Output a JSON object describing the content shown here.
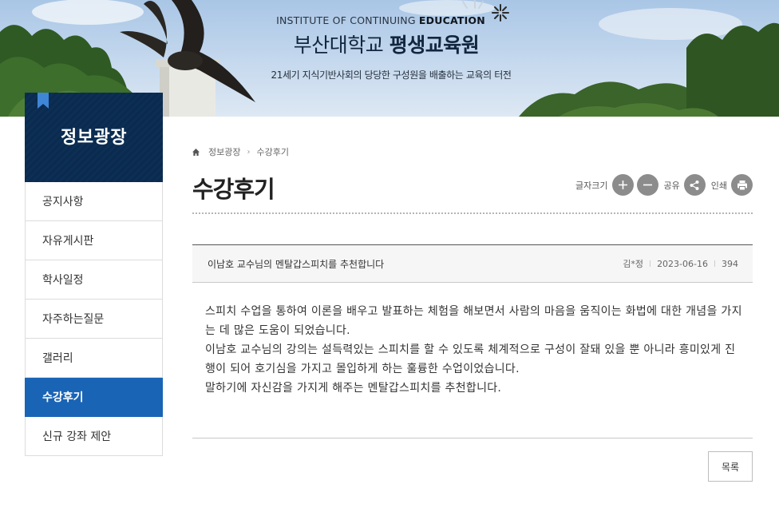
{
  "banner": {
    "institute_en_regular": "INSTITUTE OF CONTINUING ",
    "institute_en_bold": "EDUCATION",
    "name_regular": "부산대학교 ",
    "name_bold": "평생교육원",
    "slogan": "21세기 지식기반사회의 당당한 구성원을 배출하는 교육의 터전"
  },
  "sidebar": {
    "title": "정보광장",
    "items": [
      {
        "label": "공지사항"
      },
      {
        "label": "자유게시판"
      },
      {
        "label": "학사일정"
      },
      {
        "label": "자주하는질문"
      },
      {
        "label": "갤러리"
      },
      {
        "label": "수강후기",
        "active": true
      },
      {
        "label": "신규 강좌 제안"
      }
    ]
  },
  "breadcrumb": {
    "home_icon": "home-icon",
    "items": [
      "정보광장",
      "수강후기"
    ]
  },
  "page": {
    "title": "수강후기"
  },
  "tools": {
    "font_size_label": "글자크기",
    "share_label": "공유",
    "print_label": "인쇄",
    "icons": [
      "plus-icon",
      "minus-icon",
      "share-icon",
      "print-icon"
    ]
  },
  "post": {
    "subject": "이남호 교수님의 멘탈갑스피치를 추천합니다",
    "author": "김*정",
    "date": "2023-06-16",
    "views": "394",
    "body": [
      "스피치 수업을 통하여 이론을 배우고 발표하는 체험을 해보면서 사람의 마음을 움직이는 화법에 대한 개념을 가지는 데 많은 도움이 되었습니다.",
      "이남호 교수님의 강의는 설득력있는 스피치를 할 수 있도록 체계적으로 구성이 잘돼 있을 뿐 아니라 흥미있게 진행이 되어 호기심을 가지고 몰입하게 하는 훌륭한 수업이었습니다.",
      "말하기에 자신감을 가지게 해주는 멘탈갑스피치를 추천합니다."
    ]
  },
  "list_button": {
    "label": "목록"
  },
  "colors": {
    "accent": "#1a64b6",
    "sidebar_header": "#0d2f55",
    "tool_button": "#8c8c8c"
  }
}
